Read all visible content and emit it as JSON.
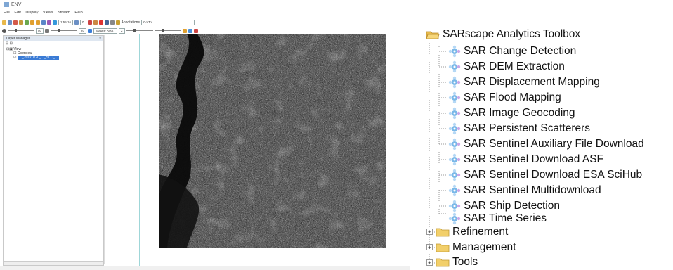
{
  "app": {
    "title": "ENVI",
    "menu": [
      "File",
      "Edit",
      "Display",
      "Views",
      "Stream",
      "Help"
    ],
    "toolbar": {
      "zoom_combo": "1:55,16",
      "zoom_combo2": "0",
      "annotations_label": "Annotations",
      "goto_value": "Go To"
    },
    "toolbar2": {
      "stretch_combo": "Square Root",
      "stretch_value": "2",
      "brightness_value": "50",
      "contrast_value": "20"
    },
    "layer_manager": {
      "title": "Layer Manager",
      "view_label": "View",
      "overview_label": "Overview",
      "layer_name": "..._20170720_..._SLC_..."
    },
    "colors": {
      "selection": "#3a7bd5",
      "panel_header": "#dfe7f1",
      "guide_line": "#9fd6d8"
    }
  },
  "toolbox": {
    "root": {
      "label": "SARscape Analytics Toolbox",
      "icon": "folder-open-icon"
    },
    "tools": [
      {
        "label": "SAR Change Detection",
        "icon": "tool-wheel-icon"
      },
      {
        "label": "SAR DEM Extraction",
        "icon": "tool-wheel-icon"
      },
      {
        "label": "SAR Displacement Mapping",
        "icon": "tool-wheel-icon"
      },
      {
        "label": "SAR Flood Mapping",
        "icon": "tool-wheel-icon"
      },
      {
        "label": "SAR Image Geocoding",
        "icon": "tool-wheel-icon"
      },
      {
        "label": "SAR Persistent Scatterers",
        "icon": "tool-wheel-icon"
      },
      {
        "label": "SAR Sentinel Auxiliary File Download",
        "icon": "tool-wheel-icon"
      },
      {
        "label": "SAR Sentinel Download ASF",
        "icon": "tool-wheel-icon"
      },
      {
        "label": "SAR Sentinel Download ESA SciHub",
        "icon": "tool-wheel-icon"
      },
      {
        "label": "SAR Sentinel Multidownload",
        "icon": "tool-wheel-icon"
      },
      {
        "label": "SAR Ship Detection",
        "icon": "tool-wheel-icon"
      },
      {
        "label": "SAR Time Series",
        "icon": "tool-wheel-icon"
      }
    ],
    "folders": [
      {
        "label": "Refinement",
        "icon": "folder-icon"
      },
      {
        "label": "Management",
        "icon": "folder-icon"
      },
      {
        "label": "Tools",
        "icon": "folder-icon"
      }
    ]
  }
}
